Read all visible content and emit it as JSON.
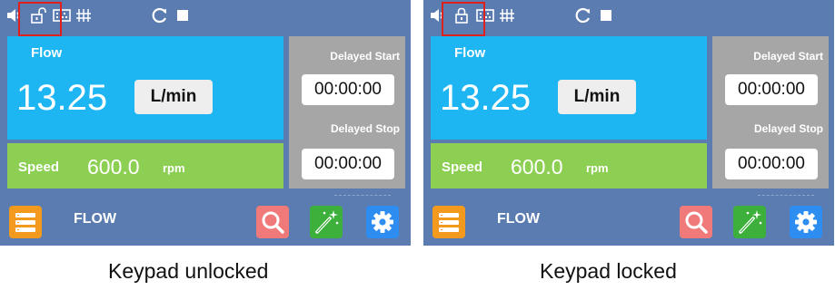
{
  "panels": [
    {
      "status": {
        "speaker_icon": "speaker-icon",
        "lock_icon": "unlocked-padlock-icon",
        "keypad_icon": "keypad-icon",
        "signal_icon": "signal-bars-icon",
        "refresh_icon": "refresh-icon",
        "stop_icon": "stop-square-icon"
      },
      "flow": {
        "label": "Flow",
        "value": "13.25",
        "unit": "L/min"
      },
      "speed": {
        "label": "Speed",
        "value": "600.0",
        "unit": "rpm"
      },
      "delayed_start": {
        "label": "Delayed Start",
        "value": "00:00:00"
      },
      "delayed_stop": {
        "label": "Delayed Stop",
        "value": "00:00:00"
      },
      "nav": {
        "label": "FLOW"
      },
      "caption": "Keypad unlocked"
    },
    {
      "status": {
        "speaker_icon": "speaker-icon",
        "lock_icon": "locked-padlock-icon",
        "keypad_icon": "keypad-icon",
        "signal_icon": "signal-bars-icon",
        "refresh_icon": "refresh-icon",
        "stop_icon": "stop-square-icon"
      },
      "flow": {
        "label": "Flow",
        "value": "13.25",
        "unit": "L/min"
      },
      "speed": {
        "label": "Speed",
        "value": "600.0",
        "unit": "rpm"
      },
      "delayed_start": {
        "label": "Delayed Start",
        "value": "00:00:00"
      },
      "delayed_stop": {
        "label": "Delayed Stop",
        "value": "00:00:00"
      },
      "nav": {
        "label": "FLOW"
      },
      "caption": "Keypad locked"
    }
  ],
  "colors": {
    "screen_bg": "#5a7cb0",
    "flow_panel": "#1eb6f2",
    "speed_panel": "#8ccf52",
    "delay_panel": "#a6a6a6",
    "highlight": "#e0201c",
    "menu_button": "#f39a1e",
    "search_button": "#f07a7a",
    "wand_button": "#3db03c",
    "settings_button": "#2d8df0"
  }
}
